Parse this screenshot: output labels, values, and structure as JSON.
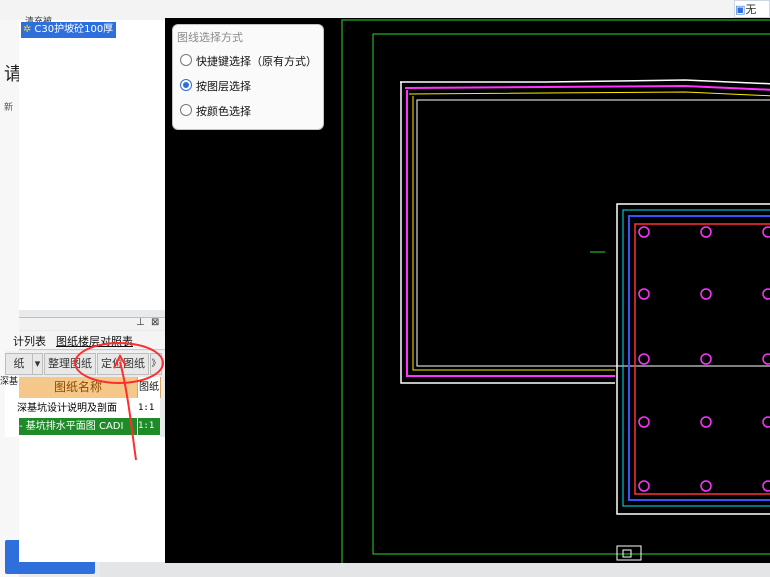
{
  "tree": {
    "parent_label": "清充被",
    "selected_node": "C30护坡砼100厚",
    "heading": "请",
    "tiny_label": "新"
  },
  "host": {
    "chip_label": "无"
  },
  "layer_panel": {
    "tabs": [
      "计列表",
      "图纸楼层对照表"
    ],
    "toolbar": {
      "first": "纸",
      "organize": "整理图纸",
      "locate": "定位图纸",
      "expand": "》"
    },
    "columns": [
      "图纸名称",
      "图纸"
    ],
    "rows": [
      {
        "name": "深基坑设计说明及剖面",
        "scale": "1:1",
        "selected": false
      },
      {
        "name": "- 基坑排水平面图 CADI",
        "scale": "1:1",
        "selected": true
      }
    ],
    "left_labels": [
      "深基"
    ]
  },
  "popup": {
    "title": "图线选择方式",
    "options": [
      {
        "label": "快捷键选择（原有方式）",
        "checked": false
      },
      {
        "label": "按图层选择",
        "checked": true
      },
      {
        "label": "按颜色选择",
        "checked": false
      }
    ]
  },
  "colors": {
    "accent": "#2f6fdc",
    "selected_row": "#1e8a28",
    "header": "#f5c88a",
    "annotation": "#ff2d2d",
    "canvas": "#000000"
  }
}
